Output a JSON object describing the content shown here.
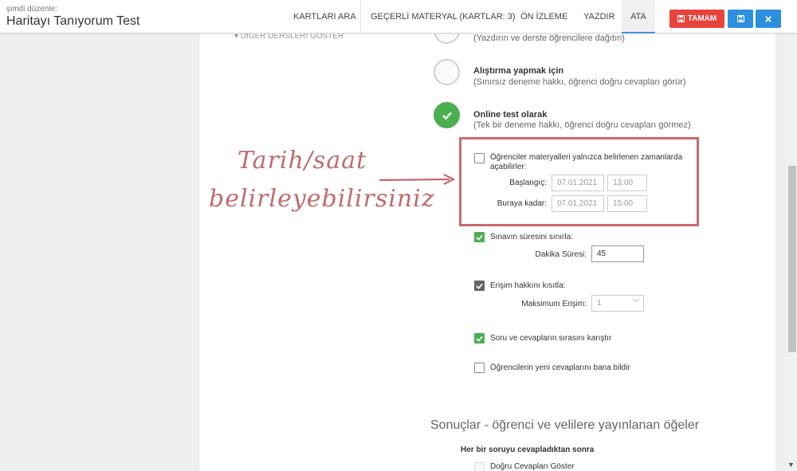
{
  "header": {
    "editing_label": "şimdi düzenle:",
    "title": "Haritayı Tanıyorum Test",
    "tabs": [
      {
        "label": "KARTLARI ARA"
      },
      {
        "label": "GEÇERLİ MATERYAL (KARTLAR: 3)"
      },
      {
        "label": "ÖN İZLEME"
      },
      {
        "label": "YAZDIR"
      },
      {
        "label": "ATA"
      }
    ],
    "ok_label": "TAMAM"
  },
  "left": {
    "show_other_label": "DİĞER DERSLERİ GÖSTER"
  },
  "options": {
    "print": {
      "desc": "(Yazdırın ve derste öğrencilere dağıtın)"
    },
    "practice": {
      "title": "Alıştırma yapmak için",
      "desc": "(Sınırsız deneme hakkı, öğrenci doğru cevapları görür)"
    },
    "online": {
      "title": "Online test olarak",
      "desc": "(Tek bir deneme hakkı, öğrenci doğru cevapları görmez)"
    }
  },
  "schedule": {
    "label_line1": "Öğrenciler materyalleri yalnızca belirlenen zamanlarda",
    "label_line2": "açabilirler:",
    "start_label": "Başlangıç:",
    "start_date": "07.01.2021",
    "start_time": "13:00",
    "end_label": "Buraya kadar:",
    "end_date": "07.01.2021",
    "end_time": "15:00"
  },
  "duration": {
    "label": "Sınavın süresini sınırla:",
    "minutes_label": "Dakika Süresi:",
    "minutes_value": "45"
  },
  "access": {
    "label": "Erişim hakkını kısıtla:",
    "max_label": "Maksimum Erişim:",
    "max_value": "1"
  },
  "shuffle": {
    "label": "Soru ve cevapların sırasını karıştır"
  },
  "notify": {
    "label": "Öğrencilerin yeni cevaplarını bana bildir"
  },
  "annotation": {
    "line1": "Tarih/saat",
    "line2": "belirleyebilirsiniz"
  },
  "results": {
    "title": "Sonuçlar - öğrenci ve velilere yayınlanan öğeler",
    "subtitle": "Her bir soruyu cevapladıktan sonra",
    "show_correct": "Doğru Cevapları Göster"
  },
  "colors": {
    "accent_red": "#e8433b",
    "accent_blue": "#2c8fdf",
    "success_green": "#4bae4f",
    "annotation": "#c96a6e"
  }
}
